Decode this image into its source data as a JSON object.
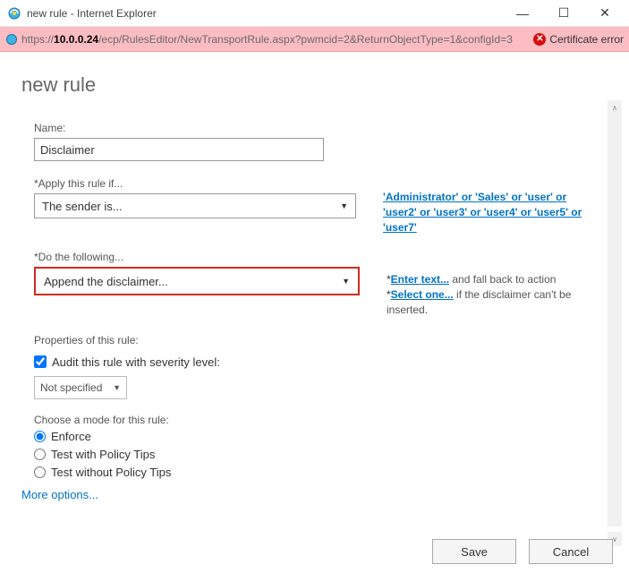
{
  "window": {
    "title": "new rule - Internet Explorer"
  },
  "address": {
    "protocol": "https://",
    "host": "10.0.0.24",
    "path": "/ecp/RulesEditor/NewTransportRule.aspx?pwmcid=2&ReturnObjectType=1&configId=3",
    "cert_error": "Certificate error"
  },
  "page": {
    "heading": "new rule",
    "name_label": "Name:",
    "name_value": "Disclaimer",
    "apply_label": "Apply this rule if...",
    "apply_value": "The sender is...",
    "apply_side": "'Administrator' or 'Sales' or 'user' or 'user2' or 'user3' or 'user4' or 'user5' or 'user7'",
    "do_label": "Do the following...",
    "do_value": "Append the disclaimer...",
    "do_side": {
      "link1": "Enter text...",
      "mid": " and fall back to action ",
      "link2": "Select one...",
      "tail": " if the disclaimer can't be inserted."
    },
    "props_label": "Properties of this rule:",
    "audit_label": "Audit this rule with severity level:",
    "audit_checked": true,
    "severity_value": "Not specified",
    "mode_label": "Choose a mode for this rule:",
    "modes": {
      "enforce": "Enforce",
      "tips": "Test with Policy Tips",
      "notips": "Test without Policy Tips"
    },
    "more": "More options...",
    "save": "Save",
    "cancel": "Cancel"
  }
}
